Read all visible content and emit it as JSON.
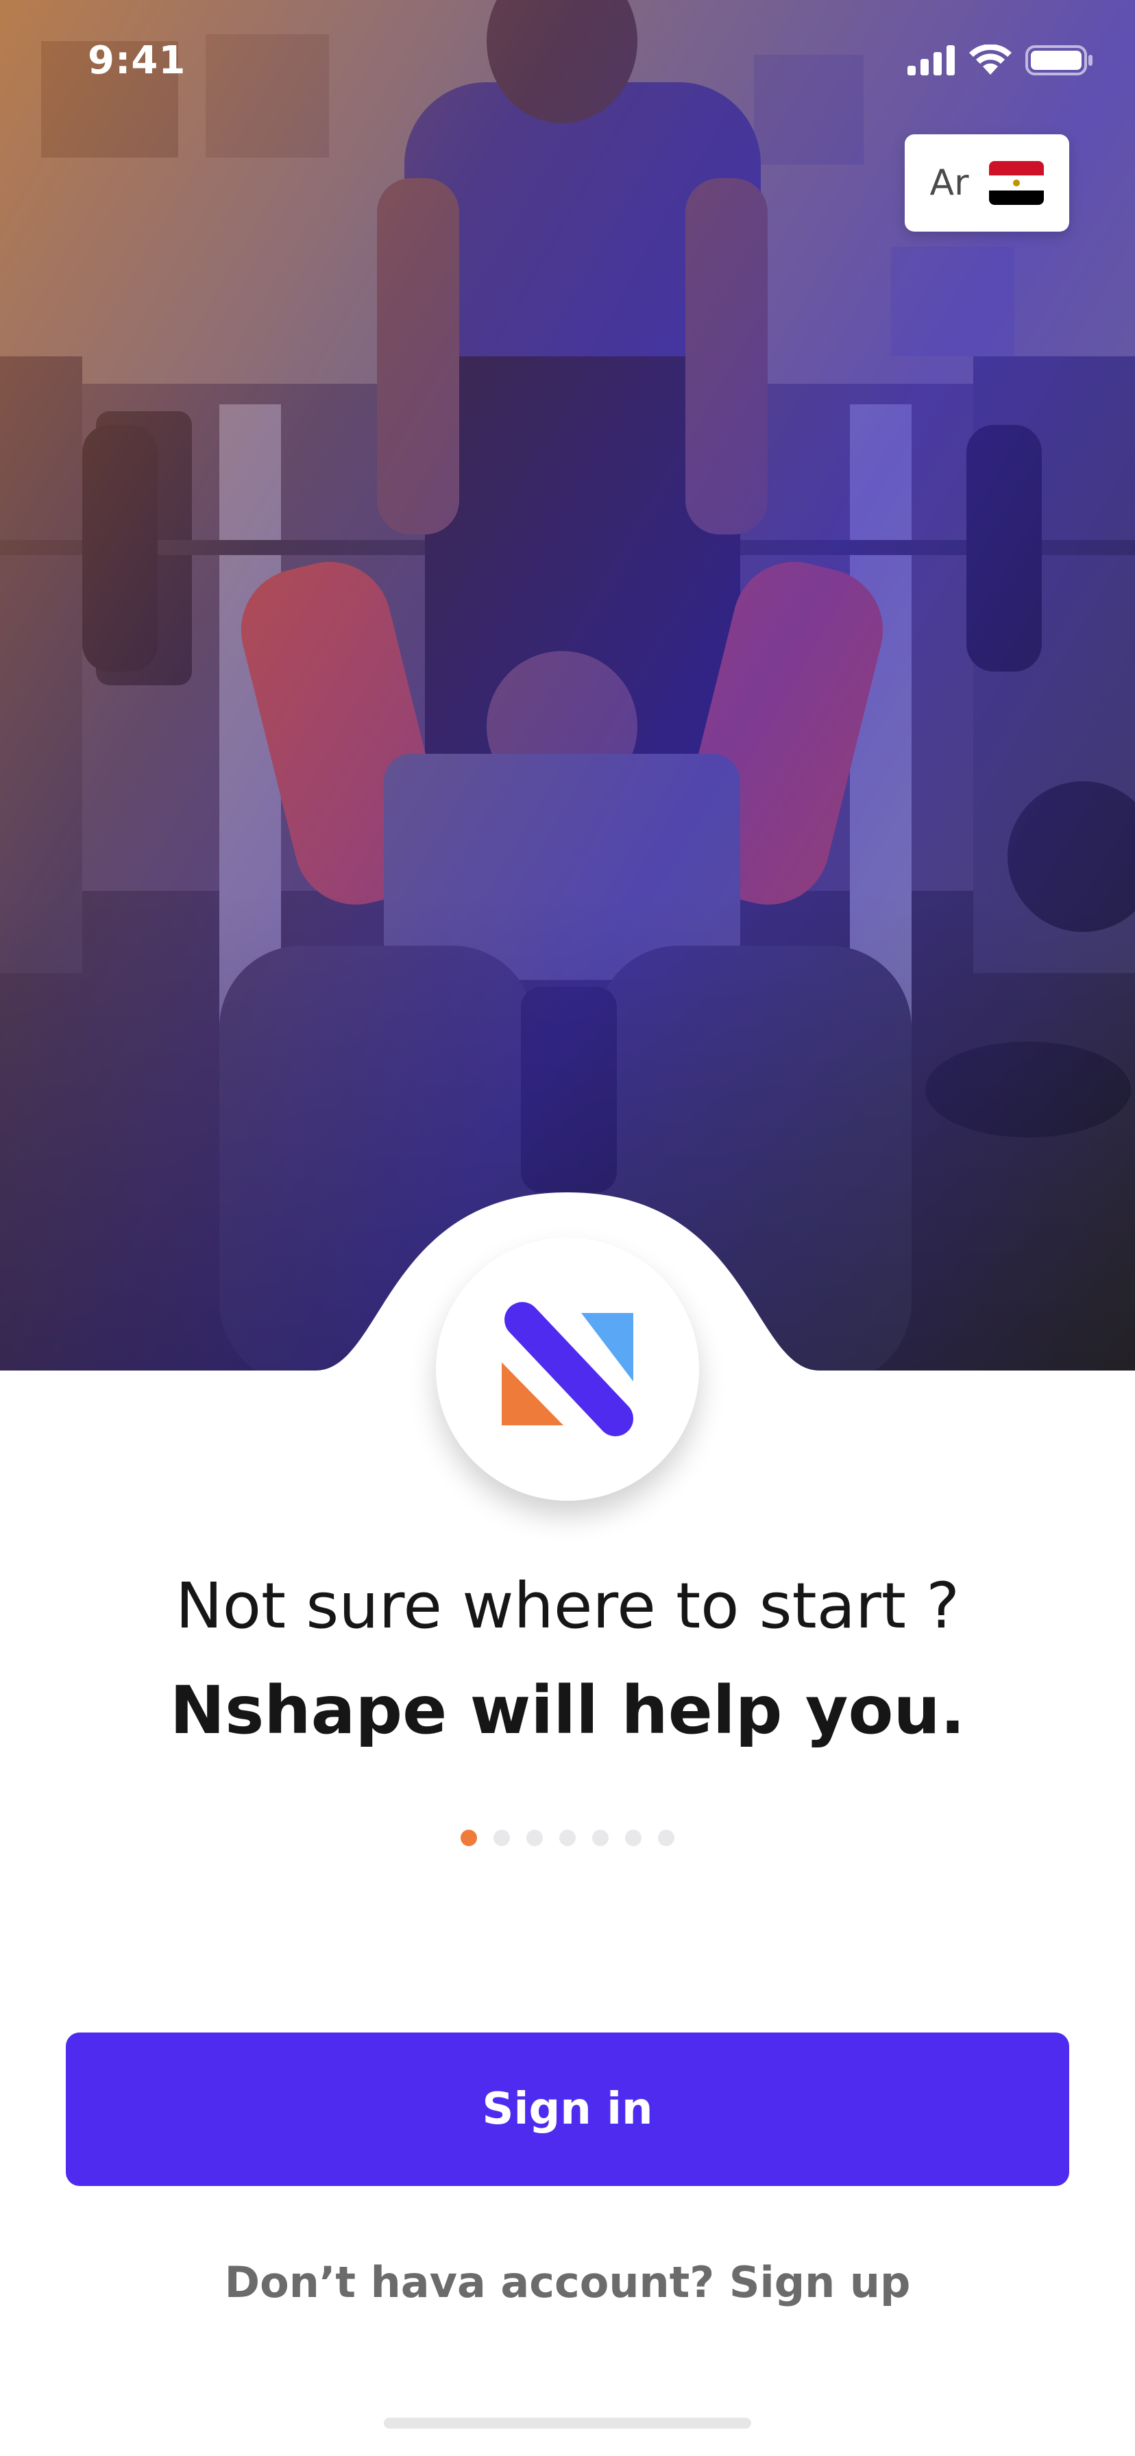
{
  "status_bar": {
    "time": "9:41",
    "icons": [
      "signal-icon",
      "wifi-icon",
      "battery-icon"
    ]
  },
  "language": {
    "label": "Ar",
    "flag_icon": "egypt-flag-icon",
    "flag_colors": [
      "#ce1126",
      "#ffffff",
      "#000000"
    ]
  },
  "hero": {
    "image": "gym-bench-press-photo"
  },
  "logo": {
    "icon": "nshape-logo-icon",
    "colors": {
      "purple": "#4f2bf0",
      "blue": "#5aa8f5",
      "orange": "#ef7b3a"
    }
  },
  "onboarding": {
    "headline": "Not sure where to start ?",
    "subheadline": "Nshape will help you.",
    "page_count": 7,
    "active_page": 1
  },
  "actions": {
    "signin_label": "Sign in",
    "signup_text": "Don’t hava account? Sign up"
  },
  "colors": {
    "accent": "#4f2bf0",
    "dot_active": "#ef7b3a",
    "dot_inactive": "#e8e8ea"
  }
}
